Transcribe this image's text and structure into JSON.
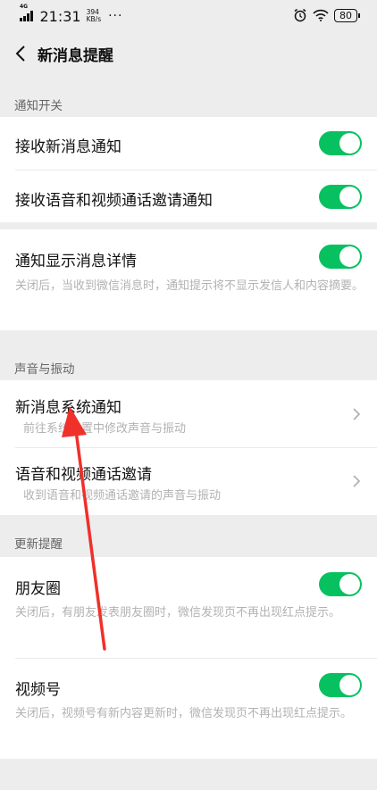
{
  "status_bar": {
    "network": "4G",
    "time": "21:31",
    "speed_value": "394",
    "speed_unit": "KB/s",
    "more": "···",
    "battery": "80"
  },
  "nav": {
    "title": "新消息提醒"
  },
  "sections": {
    "notify_switch": "通知开关",
    "sound_vibration": "声音与振动",
    "update_remind": "更新提醒"
  },
  "rows": {
    "receive_new_msg": {
      "title": "接收新消息通知",
      "enabled": true
    },
    "receive_call_invite": {
      "title": "接收语音和视频通话邀请通知",
      "enabled": true
    },
    "show_detail": {
      "title": "通知显示消息详情",
      "desc": "关闭后，当收到微信消息时，通知提示将不显示发信人和内容摘要。",
      "enabled": true
    },
    "system_notify": {
      "title": "新消息系统通知",
      "desc": "前往系统设置中修改声音与振动"
    },
    "call_invite": {
      "title": "语音和视频通话邀请",
      "desc": "收到语音和视频通话邀请的声音与振动"
    },
    "moments": {
      "title": "朋友圈",
      "desc": "关闭后，有朋友发表朋友圈时，微信发现页不再出现红点提示。",
      "enabled": true
    },
    "channels": {
      "title": "视频号",
      "desc": "关闭后，视频号有新内容更新时，微信发现页不再出现红点提示。",
      "enabled": true
    }
  },
  "colors": {
    "accent": "#07c160",
    "annotation_arrow": "#f0302a"
  }
}
